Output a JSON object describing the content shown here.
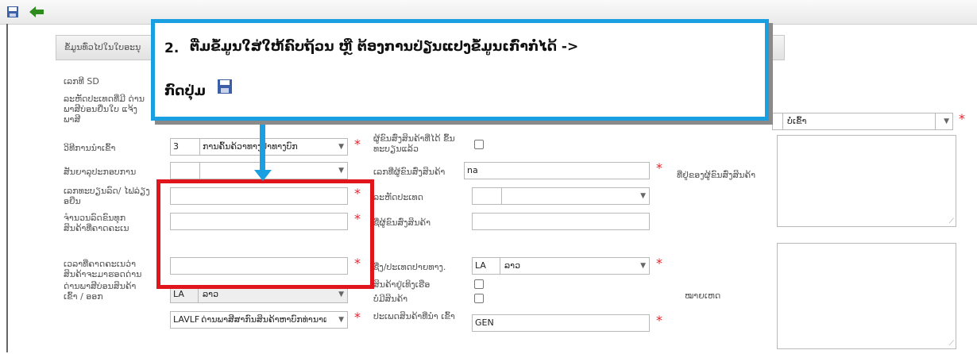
{
  "toolbar": {
    "save_icon": "save-icon",
    "back_icon": "back-arrow-icon",
    "accent": "#2e8b1e"
  },
  "panel": {
    "title": "ຂໍ້ມູນທົ່ວໄປໃນໃບອະນຸ"
  },
  "callout": {
    "number": "2.",
    "line1": "ຕື່ມຂໍ້ມູນໃສ່ໃຫ້ຄົບຖ້ວນ ຫຼື ຕ້ອງການປ່ຽນແປງຂໍ້ມູນເກົ່າກໍ່ໄດ້ ->",
    "line2": "ກົດປຸ່ມ",
    "border_color": "#1aa0e0"
  },
  "highlight_color": "#e1161d",
  "form": {
    "sd_label": "ເລກທີ SD",
    "checkpoint_label": "ລະຫັດປະເທດທີ່ມີ ດ່ານພາສີບ່ອນຍື່ນໃບ ແຈ້ງພາສີ",
    "checkpoint_code": "",
    "checkpoint_name": "ບໍ່ເຂົ້າ",
    "import_method_label": "ວິທີການນຳເຂົ້າ",
    "import_method_code": "3",
    "import_method_name": "ການຄົ້ນຄ້ວາທາງປ່າທາງບົກ",
    "business_type_label": "ສັນຍາລຸປະກອບການ",
    "business_type_code": "",
    "business_type_name": "",
    "reg_number_label": "ເລກທະບຽນລົດ/ ໄຟລ່ຽງອຍືນ",
    "reg_number_value": "",
    "quantity_label": "ຈຳນວນລົດຂົນທຸກ ສິນຄ້າທີ່ຄາດຄະເນ",
    "quantity_value": "",
    "arrival_label": "ເວລາທີ່ຄາດຄະເນວ່າ ສິນຄ້າຈະມາຮອດດ່ານ",
    "arrival_value": "",
    "border_post_label": "ດ່ານພາສີບ່ອນສິນຄ້າ ເຂົ້າ / ອອກ",
    "border_country_code": "LA",
    "border_country_name": "ລາວ",
    "border_post_code": "LAVLF",
    "border_post_name": "ດ່ານພາສີສາກົນສິນຄ້າຫາບົກທ່ານາແລ້ງ",
    "importer_registered_label": "ຜູ້ຂົນສົ່ງສິນຄ້າທີ່ໄດ້ ຂຶ້ນທະບຽນແລ້ວ",
    "importer_id_label": "ເລກທີ່ຜູ້ຂົນສົ່ງສິນຄ້າ",
    "importer_id_value": "na",
    "country_code_label": "ລະຫັດປະເທດ",
    "country_code_value": "",
    "importer_name_label": "ຊື່ຜູ້ຂົນສົ່ງສິນຄ້າ",
    "importer_name_value": "",
    "dest_country_label": "ຊື່ງ/ປະເທດປາຍທາງ.",
    "dest_country_code": "LA",
    "dest_country_name": "ລາວ",
    "stored_label": "ສິນຄ້າຢູ່ເທິງເຮືອ",
    "no_goods_label": "ບໍ່ມີສິນຄ້າ",
    "goods_type_label": "ປະເພດສິນຄ້າທີ່ນຳ ເຂົ້າ",
    "goods_type_value": "GEN",
    "address_label": "ທີ່ຢູ່ຂອງຜູ້ຂົນສົ່ງສິນຄ້າ",
    "remarks_label": "ໝາຍເຫດ",
    "required_mark": "*"
  }
}
